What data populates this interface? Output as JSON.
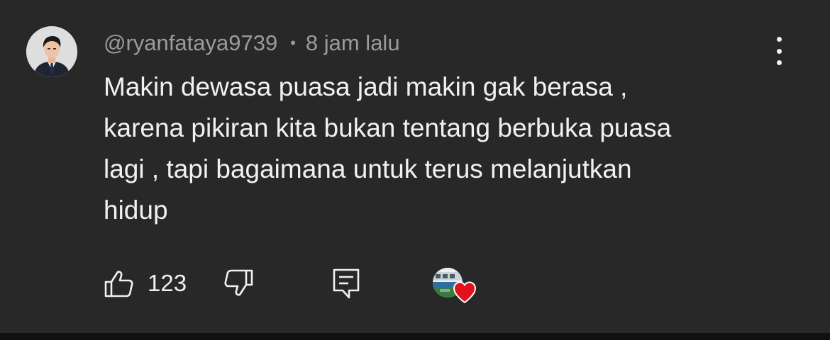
{
  "comment": {
    "author": "@ryanfataya9739",
    "separator": "•",
    "time": "8 jam lalu",
    "text_lines": [
      "Makin dewasa puasa jadi makin gak berasa ,",
      "karena pikiran kita bukan tentang berbuka puasa",
      "lagi , tapi bagaimana untuk terus melanjutkan",
      "hidup"
    ]
  },
  "actions": {
    "like_count": "123",
    "like_icon": "thumbs-up-icon",
    "dislike_icon": "thumbs-down-icon",
    "reply_icon": "reply-comment-icon",
    "creator_heart_icon": "heart-icon",
    "more_icon": "more-vertical-icon"
  },
  "colors": {
    "background": "#282828",
    "text_primary": "#f1f1f1",
    "text_secondary": "#9b9b9b",
    "heart": "#e0101c"
  }
}
